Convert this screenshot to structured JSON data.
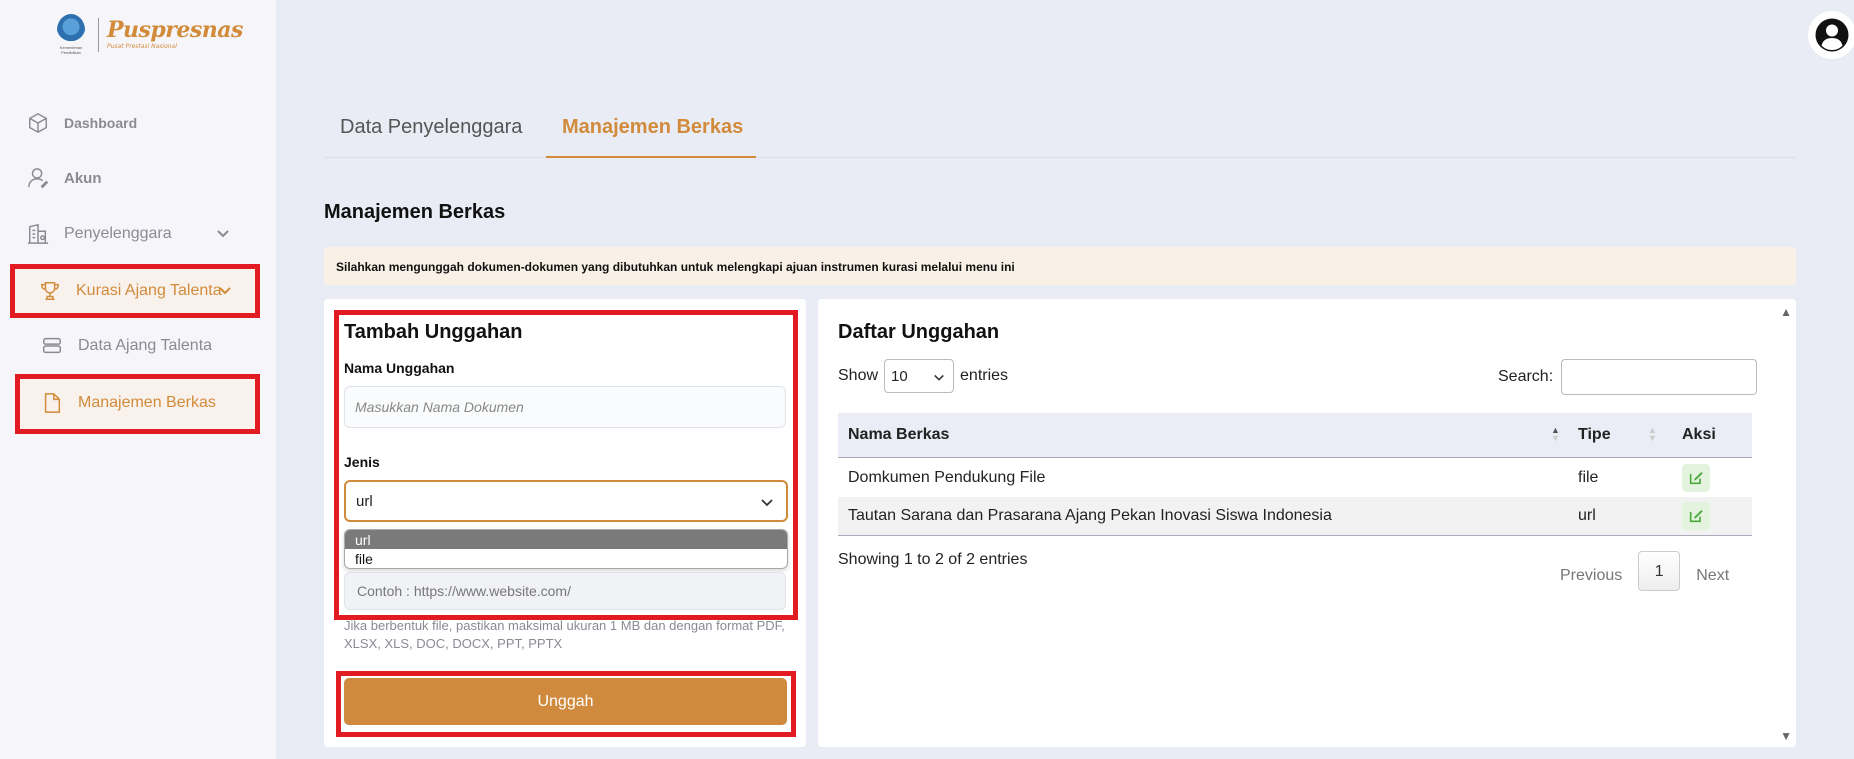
{
  "brand": {
    "name": "Puspresnas",
    "tagline": "Pusat Prestasi Nasional",
    "ministry": "Kementerian Pendidikan"
  },
  "sidebar": {
    "items": [
      {
        "label": "Dashboard",
        "icon": "cube-icon"
      },
      {
        "label": "Akun",
        "icon": "user-icon"
      },
      {
        "label": "Penyelenggara",
        "icon": "building-icon"
      },
      {
        "label": "Kurasi Ajang Talenta",
        "icon": "trophy-icon"
      },
      {
        "label": "Data Ajang Talenta",
        "icon": "stack-icon"
      },
      {
        "label": "Manajemen Berkas",
        "icon": "file-icon"
      }
    ]
  },
  "tabs": [
    {
      "label": "Data Penyelenggara"
    },
    {
      "label": "Manajemen Berkas"
    }
  ],
  "page": {
    "title": "Manajemen Berkas",
    "info": "Silahkan mengunggah dokumen-dokumen yang dibutuhkan untuk melengkapi ajuan instrumen kurasi melalui menu ini"
  },
  "form": {
    "title": "Tambah Unggahan",
    "name_label": "Nama Unggahan",
    "name_placeholder": "Masukkan Nama Dokumen",
    "type_label": "Jenis",
    "type_value": "url",
    "type_options": [
      "url",
      "file"
    ],
    "url_placeholder": "Contoh : https://www.website.com/",
    "hint": "Jika berbentuk file, pastikan maksimal ukuran 1 MB dan dengan format PDF, XLSX, XLS, DOC, DOCX, PPT, PPTX",
    "submit_label": "Unggah"
  },
  "list": {
    "title": "Daftar Unggahan",
    "show_label": "Show",
    "entries_value": "10",
    "entries_label": "entries",
    "search_label": "Search:",
    "columns": [
      "Nama Berkas",
      "Tipe",
      "Aksi"
    ],
    "rows": [
      {
        "name": "Domkumen Pendukung File",
        "type": "file"
      },
      {
        "name": "Tautan Sarana dan Prasarana Ajang Pekan Inovasi Siswa Indonesia",
        "type": "url"
      }
    ],
    "info": "Showing 1 to 2 of 2 entries",
    "prev_label": "Previous",
    "page": "1",
    "next_label": "Next"
  },
  "colors": {
    "accent": "#cf8a3d",
    "highlight": "#e21b23",
    "background": "#e9ecf5"
  }
}
